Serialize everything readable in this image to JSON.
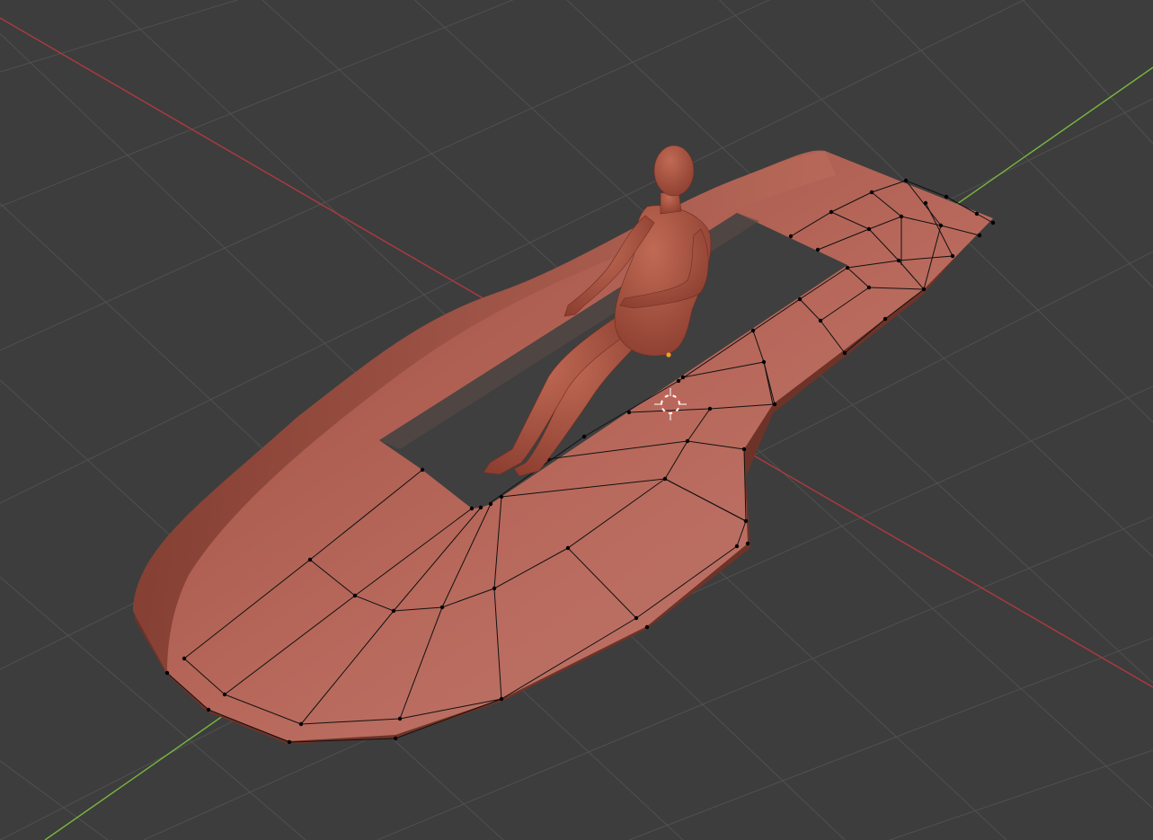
{
  "viewport": {
    "mode": "edit-mode",
    "background": "#3d3d3d",
    "grid_color": "#4f4f4f",
    "x_axis_color": "#b0393f",
    "y_axis_color": "#7ab83e",
    "mesh_color": "#b86a5e",
    "mesh_shadow_color": "#8f4234",
    "figure_color": "#a14f3f",
    "wire_color": "#111111",
    "cursor_color": "#e25c4f",
    "origin_color": "#f0a020"
  },
  "objects": [
    {
      "name": "seated-figure",
      "icon": "human-mannequin"
    },
    {
      "name": "bathtub-mesh",
      "icon": "mesh"
    }
  ],
  "overlays": [
    {
      "name": "3d-cursor",
      "icon": "crosshair-icon"
    },
    {
      "name": "object-origin",
      "icon": "dot-icon"
    }
  ]
}
